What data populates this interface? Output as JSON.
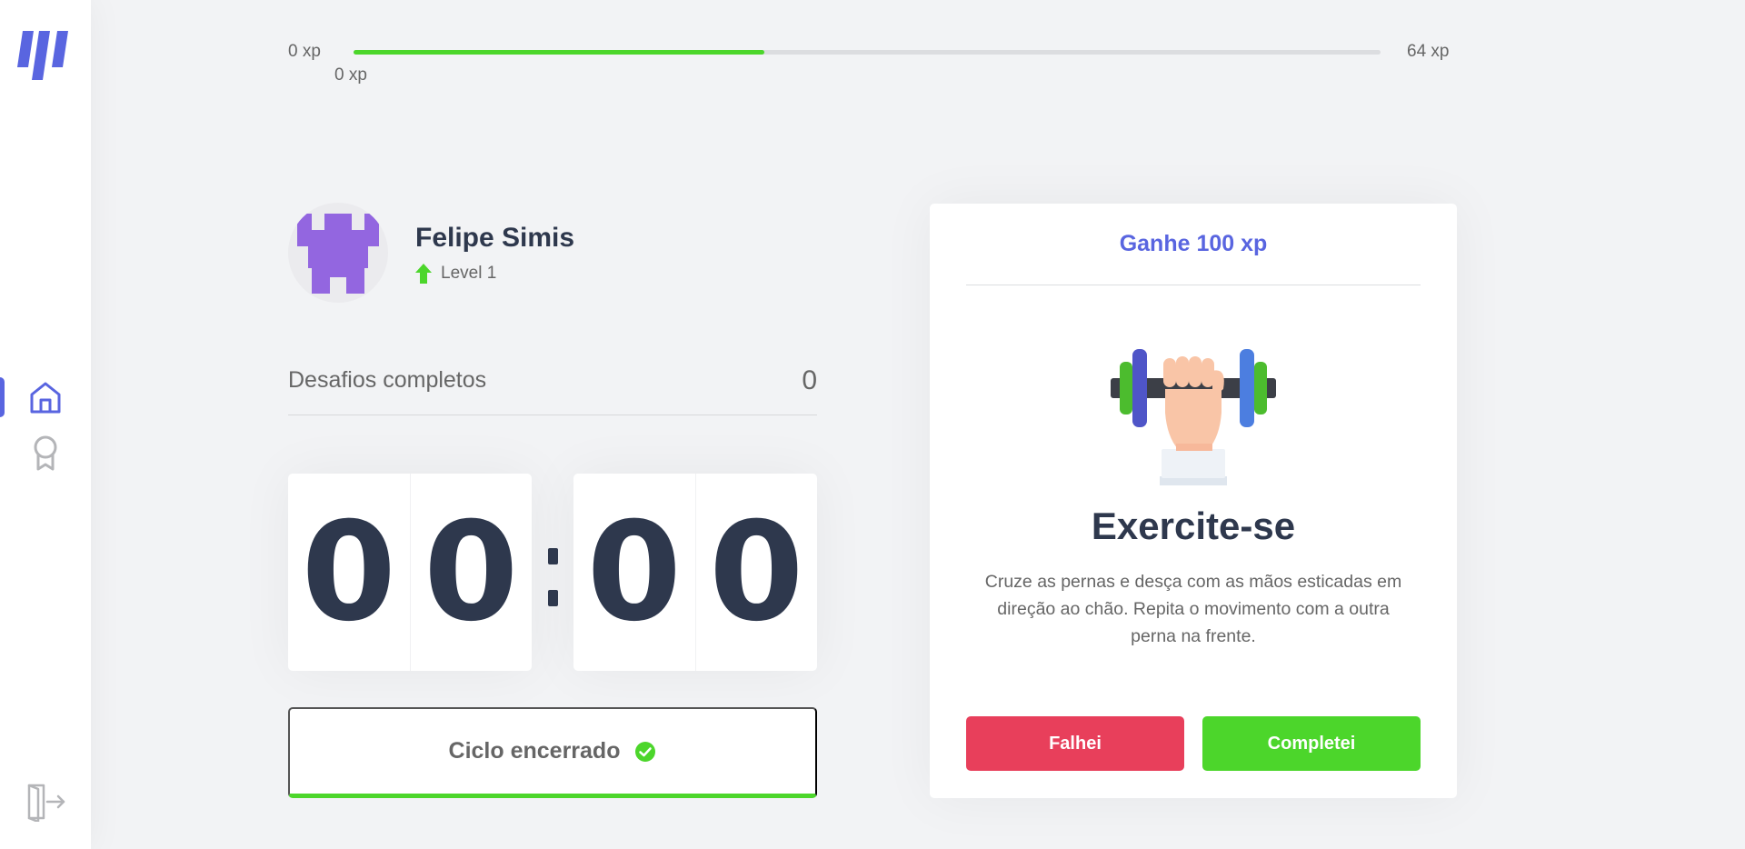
{
  "sidebar": {
    "logo": "logo-icon",
    "nav": [
      {
        "name": "home",
        "icon": "home-icon",
        "active": true
      },
      {
        "name": "leaderboard",
        "icon": "award-icon",
        "active": false
      }
    ],
    "logout_icon": "logout-icon",
    "accent_color": "#5965e0"
  },
  "xp_bar": {
    "min_label": "0 xp",
    "max_label": "64 xp",
    "current_label": "0 xp",
    "progress_fraction": 0.4,
    "fill_color": "#4cd62b"
  },
  "profile": {
    "name": "Felipe Simis",
    "level_label": "Level 1",
    "avatar": "avatar-image"
  },
  "challenges": {
    "label": "Desafios completos",
    "count": "0"
  },
  "countdown": {
    "minutes": [
      "0",
      "0"
    ],
    "seconds": [
      "0",
      "0"
    ],
    "separator": ":"
  },
  "cycle_button": {
    "label": "Ciclo encerrado",
    "icon": "check-circle-icon"
  },
  "challenge_card": {
    "reward": "Ganhe 100 xp",
    "image": "dumbbell-icon",
    "title": "Exercite-se",
    "description": "Cruze as pernas e desça com as mãos esticadas em direção ao chão. Repita o movimento com a outra perna na frente.",
    "fail_label": "Falhei",
    "complete_label": "Completei",
    "fail_color": "#e83f5b",
    "complete_color": "#4cd62b"
  }
}
